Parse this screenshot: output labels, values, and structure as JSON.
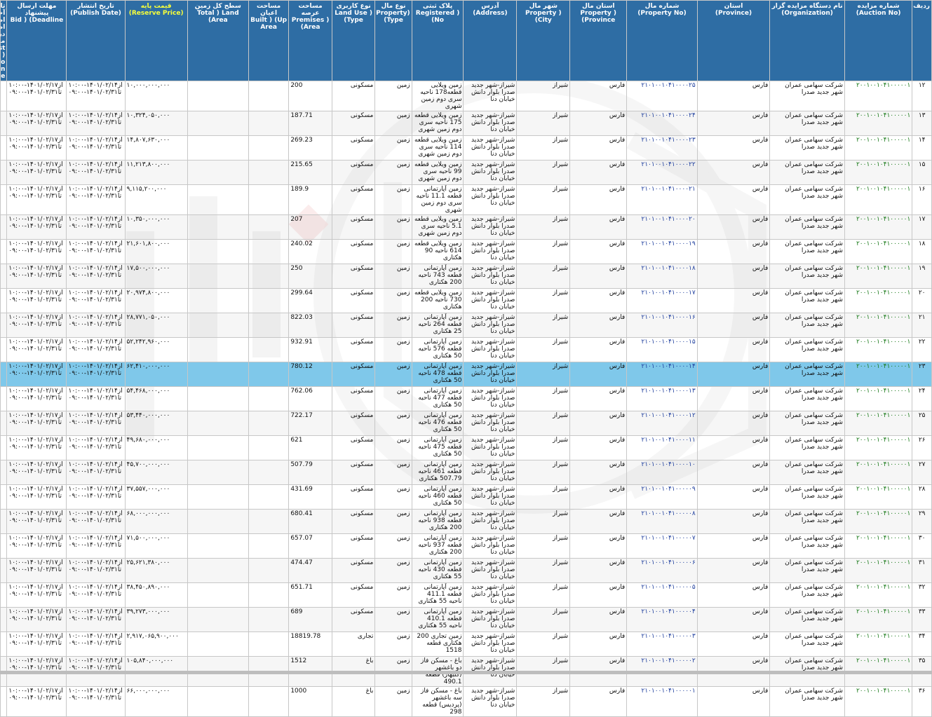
{
  "headers": [
    {
      "fa": "ردیف",
      "en": ""
    },
    {
      "fa": "شماره مزایده",
      "en": "(Auction No)"
    },
    {
      "fa": "نام دستگاه مزایده گزار",
      "en": "(Organization)"
    },
    {
      "fa": "استان",
      "en": "(Province)"
    },
    {
      "fa": "شماره مال",
      "en": "(Property No)"
    },
    {
      "fa": "استان مال",
      "en": "Property ) (Province"
    },
    {
      "fa": "شهر مال",
      "en": "Property ) (City"
    },
    {
      "fa": "آدرس",
      "en": "(Address)"
    },
    {
      "fa": "پلاک ثبتی",
      "en": "Registered ) (No"
    },
    {
      "fa": "نوع مال",
      "en": "Property) (Type"
    },
    {
      "fa": "نوع کاربری",
      "en": "Land Use ) (Type"
    },
    {
      "fa": "مساحت عرصه",
      "en": "Premises ) (Area"
    },
    {
      "fa": "مساحت اعیان",
      "en": "Built ) (Up Area"
    },
    {
      "fa": "سطح کل زمین",
      "en": "Total ) Land (Area"
    },
    {
      "fa": "قیمت پایه",
      "en": "(Reserve Price)"
    },
    {
      "fa": "تاریخ انتشار",
      "en": "(Publish Date)"
    },
    {
      "fa": "مهلت ارسال پیشنهاد",
      "en": "Bid ) (Deadline"
    },
    {
      "fa": "تاریخ آخرین اصلاحات اطلاعات در مزایده",
      "en": "Last ) Info Modification (Date"
    }
  ],
  "colors": {
    "header_bg": "#2e6da4",
    "header_text": "#ffffff",
    "reserve_price_header_text": "#f8ff3a",
    "auction_no_text": "#1a7a1a",
    "property_no_text": "#1f3f9e",
    "selected_row_bg": "#7fc8ea"
  },
  "rows": [
    {
      "idx": "۱۲",
      "auction": "۲۰۰۱۰۰۱۰۴۱۰۰۰۰۰۱",
      "org": "شرکت سهامی عمران شهر جدید صدرا",
      "prov": "فارس",
      "propno": "۲۱۰۱۰۰۱۰۴۱۰۰۰۰۲۵",
      "pprov": "فارس",
      "city": "شیراز",
      "addr": "شیراز-شهر جدید صدرا بلوار دانش خیابان دنا",
      "reg": "زمین ویلایی قطعه178 ناحیه سری دوم زمین شهری",
      "ptype": "زمین",
      "use": "مسکونی",
      "area": "200",
      "built": "",
      "total": "",
      "price": "۱۰,۰۰۰,۰۰۰,۰۰۰",
      "pub": "از۱۴۰۱/۰۲/۱۴-۱۰:۰۰\nتا۱۴۰۱/۰۲/۳۱-۰۹:۰۰",
      "dead": "از۱۴۰۱/۰۲/۱۷-۱۰:۰۰\nتا۱۴۰۱/۰۲/۳۱-۰۹:۰۰",
      "mod": ""
    },
    {
      "idx": "۱۳",
      "auction": "۲۰۰۱۰۰۱۰۴۱۰۰۰۰۰۱",
      "org": "شرکت سهامی عمران شهر جدید صدرا",
      "prov": "فارس",
      "propno": "۲۱۰۱۰۰۱۰۴۱۰۰۰۰۲۴",
      "pprov": "فارس",
      "city": "شیراز",
      "addr": "شیراز-شهر جدید صدرا بلوار دانش خیابان دنا",
      "reg": "زمین ویلایی قطعه 175 ناحیه سری دوم زمین شهری",
      "ptype": "زمین",
      "use": "مسکونی",
      "area": "187.71",
      "built": "",
      "total": "",
      "price": "۱۰,۳۲۴,۰۵۰,۰۰۰",
      "pub": "از۱۴۰۱/۰۲/۱۴-۱۰:۰۰\nتا۱۴۰۱/۰۲/۳۱-۰۹:۰۰",
      "dead": "از۱۴۰۱/۰۲/۱۷-۱۰:۰۰\nتا۱۴۰۱/۰۲/۳۱-۰۹:۰۰",
      "mod": ""
    },
    {
      "idx": "۱۴",
      "auction": "۲۰۰۱۰۰۱۰۴۱۰۰۰۰۰۱",
      "org": "شرکت سهامی عمران شهر جدید صدرا",
      "prov": "فارس",
      "propno": "۲۱۰۱۰۰۱۰۴۱۰۰۰۰۲۳",
      "pprov": "فارس",
      "city": "شیراز",
      "addr": "شیراز-شهر جدید صدرا بلوار دانش خیابان دنا",
      "reg": "زمین ویلایی قطعه 114 ناحیه سری دوم زمین شهری",
      "ptype": "زمین",
      "use": "مسکونی",
      "area": "269.23",
      "built": "",
      "total": "",
      "price": "۱۴,۸۰۷,۶۳۰,۰۰۰",
      "pub": "از۱۴۰۱/۰۲/۱۴-۱۰:۰۰\nتا۱۴۰۱/۰۲/۳۱-۰۹:۰۰",
      "dead": "از۱۴۰۱/۰۲/۱۷-۱۰:۰۰\nتا۱۴۰۱/۰۲/۳۱-۰۹:۰۰",
      "mod": ""
    },
    {
      "idx": "۱۵",
      "auction": "۲۰۰۱۰۰۱۰۴۱۰۰۰۰۰۱",
      "org": "شرکت سهامی عمران شهر جدید صدرا",
      "prov": "فارس",
      "propno": "۲۱۰۱۰۰۱۰۴۱۰۰۰۰۲۲",
      "pprov": "فارس",
      "city": "شیراز",
      "addr": "شیراز-شهر جدید صدرا بلوار دانش خیابان دنا",
      "reg": "زمین ویلایی قطعه 99 ناحیه سری دوم زمین شهری",
      "ptype": "زمین",
      "use": "مسکونی",
      "area": "215.65",
      "built": "",
      "total": "",
      "price": "۱۱,۲۱۳,۸۰۰,۰۰۰",
      "pub": "از۱۴۰۱/۰۲/۱۴-۱۰:۰۰\nتا۱۴۰۱/۰۲/۳۱-۰۹:۰۰",
      "dead": "از۱۴۰۱/۰۲/۱۷-۱۰:۰۰\nتا۱۴۰۱/۰۲/۳۱-۰۹:۰۰",
      "mod": ""
    },
    {
      "idx": "۱۶",
      "auction": "۲۰۰۱۰۰۱۰۴۱۰۰۰۰۰۱",
      "org": "شرکت سهامی عمران شهر جدید صدرا",
      "prov": "فارس",
      "propno": "۲۱۰۱۰۰۱۰۴۱۰۰۰۰۲۱",
      "pprov": "فارس",
      "city": "شیراز",
      "addr": "شیراز-شهر جدید صدرا بلوار دانش خیابان دنا",
      "reg": "زمین آپارتمانی قطعه 11.1 ناحیه سری دوم زمین شهری",
      "ptype": "زمین",
      "use": "مسکونی",
      "area": "189.9",
      "built": "",
      "total": "",
      "price": "۹,۱۱۵,۲۰۰,۰۰۰",
      "pub": "از۱۴۰۱/۰۲/۱۴-۱۰:۰۰\nتا۱۴۰۱/۰۲/۳۱-۰۹:۰۰",
      "dead": "از۱۴۰۱/۰۲/۱۷-۱۰:۰۰\nتا۱۴۰۱/۰۲/۳۱-۰۹:۰۰",
      "mod": ""
    },
    {
      "idx": "۱۷",
      "auction": "۲۰۰۱۰۰۱۰۴۱۰۰۰۰۰۱",
      "org": "شرکت سهامی عمران شهر جدید صدرا",
      "prov": "فارس",
      "propno": "۲۱۰۱۰۰۱۰۴۱۰۰۰۰۲۰",
      "pprov": "فارس",
      "city": "شیراز",
      "addr": "شیراز-شهر جدید صدرا بلوار دانش خیابان دنا",
      "reg": "زمین ویلایی قطعه 5.1 ناحیه سری دوم زمین شهری",
      "ptype": "زمین",
      "use": "مسکونی",
      "area": "207",
      "built": "",
      "total": "",
      "price": "۱۰,۳۵۰,۰۰۰,۰۰۰",
      "pub": "از۱۴۰۱/۰۲/۱۴-۱۰:۰۰\nتا۱۴۰۱/۰۲/۳۱-۰۹:۰۰",
      "dead": "از۱۴۰۱/۰۲/۱۷-۱۰:۰۰\nتا۱۴۰۱/۰۲/۳۱-۰۹:۰۰",
      "mod": ""
    },
    {
      "idx": "۱۸",
      "auction": "۲۰۰۱۰۰۱۰۴۱۰۰۰۰۰۱",
      "org": "شرکت سهامی عمران شهر جدید صدرا",
      "prov": "فارس",
      "propno": "۲۱۰۱۰۰۱۰۴۱۰۰۰۰۱۹",
      "pprov": "فارس",
      "city": "شیراز",
      "addr": "شیراز-شهر جدید صدرا بلوار دانش خیابان دنا",
      "reg": "زمین ویلایی قطعه 614 ناحیه 90 هکتاری",
      "ptype": "زمین",
      "use": "مسکونی",
      "area": "240.02",
      "built": "",
      "total": "",
      "price": "۲۱,۶۰۱,۸۰۰,۰۰۰",
      "pub": "از۱۴۰۱/۰۲/۱۴-۱۰:۰۰\nتا۱۴۰۱/۰۲/۳۱-۰۹:۰۰",
      "dead": "از۱۴۰۱/۰۲/۱۷-۱۰:۰۰\nتا۱۴۰۱/۰۲/۳۱-۰۹:۰۰",
      "mod": ""
    },
    {
      "idx": "۱۹",
      "auction": "۲۰۰۱۰۰۱۰۴۱۰۰۰۰۰۱",
      "org": "شرکت سهامی عمران شهر جدید صدرا",
      "prov": "فارس",
      "propno": "۲۱۰۱۰۰۱۰۴۱۰۰۰۰۱۸",
      "pprov": "فارس",
      "city": "شیراز",
      "addr": "شیراز-شهر جدید صدرا بلوار دانش خیابان دنا",
      "reg": "زمین آپارتمانی قطعه 743 ناحیه 200 هکتاری",
      "ptype": "زمین",
      "use": "مسکونی",
      "area": "250",
      "built": "",
      "total": "",
      "price": "۱۷,۵۰۰,۰۰۰,۰۰۰",
      "pub": "از۱۴۰۱/۰۲/۱۴-۱۰:۰۰\nتا۱۴۰۱/۰۲/۳۱-۰۹:۰۰",
      "dead": "از۱۴۰۱/۰۲/۱۷-۱۰:۰۰\nتا۱۴۰۱/۰۲/۳۱-۰۹:۰۰",
      "mod": ""
    },
    {
      "idx": "۲۰",
      "auction": "۲۰۰۱۰۰۱۰۴۱۰۰۰۰۰۱",
      "org": "شرکت سهامی عمران شهر جدید صدرا",
      "prov": "فارس",
      "propno": "۲۱۰۱۰۰۱۰۴۱۰۰۰۰۱۷",
      "pprov": "فارس",
      "city": "شیراز",
      "addr": "شیراز-شهر جدید صدرا بلوار دانش خیابان دنا",
      "reg": "زمین ویلایی قطعه 730 ناحیه 200 هکتاری",
      "ptype": "زمین",
      "use": "مسکونی",
      "area": "299.64",
      "built": "",
      "total": "",
      "price": "۲۰,۹۷۴,۸۰۰,۰۰۰",
      "pub": "از۱۴۰۱/۰۲/۱۴-۱۰:۰۰\nتا۱۴۰۱/۰۲/۳۱-۰۹:۰۰",
      "dead": "از۱۴۰۱/۰۲/۱۷-۱۰:۰۰\nتا۱۴۰۱/۰۲/۳۱-۰۹:۰۰",
      "mod": ""
    },
    {
      "idx": "۲۱",
      "auction": "۲۰۰۱۰۰۱۰۴۱۰۰۰۰۰۱",
      "org": "شرکت سهامی عمران شهر جدید صدرا",
      "prov": "فارس",
      "propno": "۲۱۰۱۰۰۱۰۴۱۰۰۰۰۱۶",
      "pprov": "فارس",
      "city": "شیراز",
      "addr": "شیراز-شهر جدید صدرا بلوار دانش خیابان دنا",
      "reg": "زمین آپارتمانی قطعه 264 ناحیه 25 هکتاری",
      "ptype": "زمین",
      "use": "مسکونی",
      "area": "822.03",
      "built": "",
      "total": "",
      "price": "۲۸,۷۷۱,۰۵۰,۰۰۰",
      "pub": "از۱۴۰۱/۰۲/۱۴-۱۰:۰۰\nتا۱۴۰۱/۰۲/۳۱-۰۹:۰۰",
      "dead": "از۱۴۰۱/۰۲/۱۷-۱۰:۰۰\nتا۱۴۰۱/۰۲/۳۱-۰۹:۰۰",
      "mod": ""
    },
    {
      "idx": "۲۲",
      "auction": "۲۰۰۱۰۰۱۰۴۱۰۰۰۰۰۱",
      "org": "شرکت سهامی عمران شهر جدید صدرا",
      "prov": "فارس",
      "propno": "۲۱۰۱۰۰۱۰۴۱۰۰۰۰۱۵",
      "pprov": "فارس",
      "city": "شیراز",
      "addr": "شیراز-شهر جدید صدرا بلوار دانش خیابان دنا",
      "reg": "زمین آپارتمانی قطعه 576 ناحیه 50 هکتاری",
      "ptype": "زمین",
      "use": "مسکونی",
      "area": "932.91",
      "built": "",
      "total": "",
      "price": "۵۲,۲۴۲,۹۶۰,۰۰۰",
      "pub": "از۱۴۰۱/۰۲/۱۴-۱۰:۰۰\nتا۱۴۰۱/۰۲/۳۱-۰۹:۰۰",
      "dead": "از۱۴۰۱/۰۲/۱۷-۱۰:۰۰\nتا۱۴۰۱/۰۲/۳۱-۰۹:۰۰",
      "mod": ""
    },
    {
      "idx": "۲۳",
      "auction": "۲۰۰۱۰۰۱۰۴۱۰۰۰۰۰۱",
      "org": "شرکت سهامی عمران شهر جدید صدرا",
      "prov": "فارس",
      "propno": "۲۱۰۱۰۰۱۰۴۱۰۰۰۰۱۴",
      "pprov": "فارس",
      "city": "شیراز",
      "addr": "شیراز-شهر جدید صدرا بلوار دانش خیابان دنا",
      "reg": "زمین آپارتمانی قطعه 478 ناحیه 50 هکتاری",
      "ptype": "زمین",
      "use": "مسکونی",
      "area": "780.12",
      "built": "",
      "total": "",
      "price": "۶۲,۴۱۰,۰۰۰,۰۰۰",
      "pub": "از۱۴۰۱/۰۲/۱۴-۱۰:۰۰\nتا۱۴۰۱/۰۲/۳۱-۰۹:۰۰",
      "dead": "از۱۴۰۱/۰۲/۱۷-۱۰:۰۰\nتا۱۴۰۱/۰۲/۳۱-۰۹:۰۰",
      "mod": "",
      "selected": true
    },
    {
      "idx": "۲۴",
      "auction": "۲۰۰۱۰۰۱۰۴۱۰۰۰۰۰۱",
      "org": "شرکت سهامی عمران شهر جدید صدرا",
      "prov": "فارس",
      "propno": "۲۱۰۱۰۰۱۰۴۱۰۰۰۰۱۳",
      "pprov": "فارس",
      "city": "شیراز",
      "addr": "شیراز-شهر جدید صدرا بلوار دانش خیابان دنا",
      "reg": "زمین آپارتمانی قطعه 477 ناحیه 50 هکتاری",
      "ptype": "زمین",
      "use": "مسکونی",
      "area": "762.06",
      "built": "",
      "total": "",
      "price": "۵۴,۴۶۸,۰۰۰,۰۰۰",
      "pub": "از۱۴۰۱/۰۲/۱۴-۱۰:۰۰\nتا۱۴۰۱/۰۲/۳۱-۰۹:۰۰",
      "dead": "از۱۴۰۱/۰۲/۱۷-۱۰:۰۰\nتا۱۴۰۱/۰۲/۳۱-۰۹:۰۰",
      "mod": ""
    },
    {
      "idx": "۲۵",
      "auction": "۲۰۰۱۰۰۱۰۴۱۰۰۰۰۰۱",
      "org": "شرکت سهامی عمران شهر جدید صدرا",
      "prov": "فارس",
      "propno": "۲۱۰۱۰۰۱۰۴۱۰۰۰۰۱۲",
      "pprov": "فارس",
      "city": "شیراز",
      "addr": "شیراز-شهر جدید صدرا بلوار دانش خیابان دنا",
      "reg": "زمین آپارتمانی قطعه 476 ناحیه 50 هکتاری",
      "ptype": "زمین",
      "use": "مسکونی",
      "area": "722.17",
      "built": "",
      "total": "",
      "price": "۵۳,۴۴۰,۰۰۰,۰۰۰",
      "pub": "از۱۴۰۱/۰۲/۱۴-۱۰:۰۰\nتا۱۴۰۱/۰۲/۳۱-۰۹:۰۰",
      "dead": "از۱۴۰۱/۰۲/۱۷-۱۰:۰۰\nتا۱۴۰۱/۰۲/۳۱-۰۹:۰۰",
      "mod": ""
    },
    {
      "idx": "۲۶",
      "auction": "۲۰۰۱۰۰۱۰۴۱۰۰۰۰۰۱",
      "org": "شرکت سهامی عمران شهر جدید صدرا",
      "prov": "فارس",
      "propno": "۲۱۰۱۰۰۱۰۴۱۰۰۰۰۱۱",
      "pprov": "فارس",
      "city": "شیراز",
      "addr": "شیراز-شهر جدید صدرا بلوار دانش خیابان دنا",
      "reg": "زمین آپارتمانی قطعه 475 ناحیه 50 هکتاری",
      "ptype": "زمین",
      "use": "مسکونی",
      "area": "621",
      "built": "",
      "total": "",
      "price": "۴۹,۶۸۰,۰۰۰,۰۰۰",
      "pub": "از۱۴۰۱/۰۲/۱۴-۱۰:۰۰\nتا۱۴۰۱/۰۲/۳۱-۰۹:۰۰",
      "dead": "از۱۴۰۱/۰۲/۱۷-۱۰:۰۰\nتا۱۴۰۱/۰۲/۳۱-۰۹:۰۰",
      "mod": ""
    },
    {
      "idx": "۲۷",
      "auction": "۲۰۰۱۰۰۱۰۴۱۰۰۰۰۰۱",
      "org": "شرکت سهامی عمران شهر جدید صدرا",
      "prov": "فارس",
      "propno": "۲۱۰۱۰۰۱۰۴۱۰۰۰۰۱۰",
      "pprov": "فارس",
      "city": "شیراز",
      "addr": "شیراز-شهر جدید صدرا بلوار دانش خیابان دنا",
      "reg": "زمین آپارتمانی قطعه 461 ناحیه 507.79 هکتاری",
      "ptype": "زمین",
      "use": "مسکونی",
      "area": "507.79",
      "built": "",
      "total": "",
      "price": "۴۵,۷۰۰,۰۰۰,۰۰۰",
      "pub": "از۱۴۰۱/۰۲/۱۴-۱۰:۰۰\nتا۱۴۰۱/۰۲/۳۱-۰۹:۰۰",
      "dead": "از۱۴۰۱/۰۲/۱۷-۱۰:۰۰\nتا۱۴۰۱/۰۲/۳۱-۰۹:۰۰",
      "mod": ""
    },
    {
      "idx": "۲۸",
      "auction": "۲۰۰۱۰۰۱۰۴۱۰۰۰۰۰۱",
      "org": "شرکت سهامی عمران شهر جدید صدرا",
      "prov": "فارس",
      "propno": "۲۱۰۱۰۰۱۰۴۱۰۰۰۰۰۹",
      "pprov": "فارس",
      "city": "شیراز",
      "addr": "شیراز-شهر جدید صدرا بلوار دانش خیابان دنا",
      "reg": "زمین آپارتمانی قطعه 460 ناحیه 50 هکتاری",
      "ptype": "زمین",
      "use": "مسکونی",
      "area": "431.69",
      "built": "",
      "total": "",
      "price": "۳۷,۵۵۷,۰۰۰,۰۰۰",
      "pub": "از۱۴۰۱/۰۲/۱۴-۱۰:۰۰\nتا۱۴۰۱/۰۲/۳۱-۰۹:۰۰",
      "dead": "از۱۴۰۱/۰۲/۱۷-۱۰:۰۰\nتا۱۴۰۱/۰۲/۳۱-۰۹:۰۰",
      "mod": ""
    },
    {
      "idx": "۲۹",
      "auction": "۲۰۰۱۰۰۱۰۴۱۰۰۰۰۰۱",
      "org": "شرکت سهامی عمران شهر جدید صدرا",
      "prov": "فارس",
      "propno": "۲۱۰۱۰۰۱۰۴۱۰۰۰۰۰۸",
      "pprov": "فارس",
      "city": "شیراز",
      "addr": "شیراز-شهر جدید صدرا بلوار دانش خیابان دنا",
      "reg": "زمین آپارتمانی قطعه 938 ناحیه 200 هکتاری",
      "ptype": "زمین",
      "use": "مسکونی",
      "area": "680.41",
      "built": "",
      "total": "",
      "price": "۶۸,۰۰۰,۰۰۰,۰۰۰",
      "pub": "از۱۴۰۱/۰۲/۱۴-۱۰:۰۰\nتا۱۴۰۱/۰۲/۳۱-۰۹:۰۰",
      "dead": "از۱۴۰۱/۰۲/۱۷-۱۰:۰۰\nتا۱۴۰۱/۰۲/۳۱-۰۹:۰۰",
      "mod": ""
    },
    {
      "idx": "۳۰",
      "auction": "۲۰۰۱۰۰۱۰۴۱۰۰۰۰۰۱",
      "org": "شرکت سهامی عمران شهر جدید صدرا",
      "prov": "فارس",
      "propno": "۲۱۰۱۰۰۱۰۴۱۰۰۰۰۰۷",
      "pprov": "فارس",
      "city": "شیراز",
      "addr": "شیراز-شهر جدید صدرا بلوار دانش خیابان دنا",
      "reg": "زمین آپارتمانی قطعه 937 ناحیه 200 هکتاری",
      "ptype": "زمین",
      "use": "مسکونی",
      "area": "657.07",
      "built": "",
      "total": "",
      "price": "۷۱,۵۰۰,۰۰۰,۰۰۰",
      "pub": "از۱۴۰۱/۰۲/۱۴-۱۰:۰۰\nتا۱۴۰۱/۰۲/۳۱-۰۹:۰۰",
      "dead": "از۱۴۰۱/۰۲/۱۷-۱۰:۰۰\nتا۱۴۰۱/۰۲/۳۱-۰۹:۰۰",
      "mod": ""
    },
    {
      "idx": "۳۱",
      "auction": "۲۰۰۱۰۰۱۰۴۱۰۰۰۰۰۱",
      "org": "شرکت سهامی عمران شهر جدید صدرا",
      "prov": "فارس",
      "propno": "۲۱۰۱۰۰۱۰۴۱۰۰۰۰۰۶",
      "pprov": "فارس",
      "city": "شیراز",
      "addr": "شیراز-شهر جدید صدرا بلوار دانش خیابان دنا",
      "reg": "زمین آپارتمانی قطعه 430 ناحیه 55 هکتاری",
      "ptype": "زمین",
      "use": "مسکونی",
      "area": "474.47",
      "built": "",
      "total": "",
      "price": "۲۵,۶۲۱,۳۸۰,۰۰۰",
      "pub": "از۱۴۰۱/۰۲/۱۴-۱۰:۰۰\nتا۱۴۰۱/۰۲/۳۱-۰۹:۰۰",
      "dead": "از۱۴۰۱/۰۲/۱۷-۱۰:۰۰\nتا۱۴۰۱/۰۲/۳۱-۰۹:۰۰",
      "mod": ""
    },
    {
      "idx": "۳۲",
      "auction": "۲۰۰۱۰۰۱۰۴۱۰۰۰۰۰۱",
      "org": "شرکت سهامی عمران شهر جدید صدرا",
      "prov": "فارس",
      "propno": "۲۱۰۱۰۰۱۰۴۱۰۰۰۰۰۵",
      "pprov": "فارس",
      "city": "شیراز",
      "addr": "شیراز-شهر جدید صدرا بلوار دانش خیابان دنا",
      "reg": "زمین آپارتمانی قطعه 411.1 ناحیه 55 هکتاری",
      "ptype": "زمین",
      "use": "مسکونی",
      "area": "651.71",
      "built": "",
      "total": "",
      "price": "۳۸,۴۵۰,۸۹۰,۰۰۰",
      "pub": "از۱۴۰۱/۰۲/۱۴-۱۰:۰۰\nتا۱۴۰۱/۰۲/۳۱-۰۹:۰۰",
      "dead": "از۱۴۰۱/۰۲/۱۷-۱۰:۰۰\nتا۱۴۰۱/۰۲/۳۱-۰۹:۰۰",
      "mod": ""
    },
    {
      "idx": "۳۳",
      "auction": "۲۰۰۱۰۰۱۰۴۱۰۰۰۰۰۱",
      "org": "شرکت سهامی عمران شهر جدید صدرا",
      "prov": "فارس",
      "propno": "۲۱۰۱۰۰۱۰۴۱۰۰۰۰۰۴",
      "pprov": "فارس",
      "city": "شیراز",
      "addr": "شیراز-شهر جدید صدرا بلوار دانش خیابان دنا",
      "reg": "زمین آپارتمانی قطعه 410.1 ناحیه 55 هکتاری",
      "ptype": "زمین",
      "use": "مسکونی",
      "area": "689",
      "built": "",
      "total": "",
      "price": "۳۹,۲۷۳,۰۰۰,۰۰۰",
      "pub": "از۱۴۰۱/۰۲/۱۴-۱۰:۰۰\nتا۱۴۰۱/۰۲/۳۱-۰۹:۰۰",
      "dead": "از۱۴۰۱/۰۲/۱۷-۱۰:۰۰\nتا۱۴۰۱/۰۲/۳۱-۰۹:۰۰",
      "mod": ""
    },
    {
      "idx": "۳۴",
      "auction": "۲۰۰۱۰۰۱۰۴۱۰۰۰۰۰۱",
      "org": "شرکت سهامی عمران شهر جدید صدرا",
      "prov": "فارس",
      "propno": "۲۱۰۱۰۰۱۰۴۱۰۰۰۰۰۳",
      "pprov": "فارس",
      "city": "شیراز",
      "addr": "شیراز-شهر جدید صدرا بلوار دانش خیابان دنا",
      "reg": "زمین تجاری 200 هکتاری قطعه 1518",
      "ptype": "زمین",
      "use": "تجاری",
      "area": "18819.78",
      "built": "",
      "total": "",
      "price": "۲,۹۱۷,۰۶۵,۹۰۰,۰۰۰",
      "pub": "از۱۴۰۱/۰۲/۱۴-۱۰:۰۰\nتا۱۴۰۱/۰۲/۳۱-۰۹:۰۰",
      "dead": "از۱۴۰۱/۰۲/۱۷-۱۰:۰۰\nتا۱۴۰۱/۰۲/۳۱-۰۹:۰۰",
      "mod": ""
    },
    {
      "idx": "۳۵",
      "auction": "۲۰۰۱۰۰۱۰۴۱۰۰۰۰۰۱",
      "org": "شرکت سهامی عمران شهر جدید صدرا",
      "prov": "فارس",
      "propno": "۲۱۰۱۰۰۱۰۴۱۰۰۰۰۰۲",
      "pprov": "فارس",
      "city": "شیراز",
      "addr": "شیراز-شهر جدید صدرا بلوار دانش خیابان دنا",
      "reg": "باغ - مسکن فاز دو باغشهر (گلبهار) قطعه 490.1",
      "ptype": "زمین",
      "use": "باغ",
      "area": "1512",
      "built": "",
      "total": "",
      "price": "۱۰۵,۸۴۰,۰۰۰,۰۰۰",
      "pub": "از۱۴۰۱/۰۲/۱۴-۱۰:۰۰\nتا۱۴۰۱/۰۲/۳۱-۰۹:۰۰",
      "dead": "از۱۴۰۱/۰۲/۱۷-۱۰:۰۰\nتا۱۴۰۱/۰۲/۳۱-۰۹:۰۰",
      "mod": ""
    },
    {
      "idx": "۳۶",
      "auction": "۲۰۰۱۰۰۱۰۴۱۰۰۰۰۰۱",
      "org": "شرکت سهامی عمران شهر جدید صدرا",
      "prov": "فارس",
      "propno": "۲۱۰۱۰۰۱۰۴۱۰۰۰۰۰۱",
      "pprov": "فارس",
      "city": "شیراز",
      "addr": "شیراز-شهر جدید صدرا بلوار دانش خیابان دنا",
      "reg": "باغ - مسکن فاز سه باغشهر (پردیس) قطعه 298",
      "ptype": "زمین",
      "use": "باغ",
      "area": "1000",
      "built": "",
      "total": "",
      "price": "۶۶,۰۰۰,۰۰۰,۰۰۰",
      "pub": "از۱۴۰۱/۰۲/۱۴-۱۰:۰۰\nتا۱۴۰۱/۰۲/۳۱-۰۹:۰۰",
      "dead": "از۱۴۰۱/۰۲/۱۷-۱۰:۰۰\nتا۱۴۰۱/۰۲/۳۱-۰۹:۰۰",
      "mod": ""
    }
  ]
}
